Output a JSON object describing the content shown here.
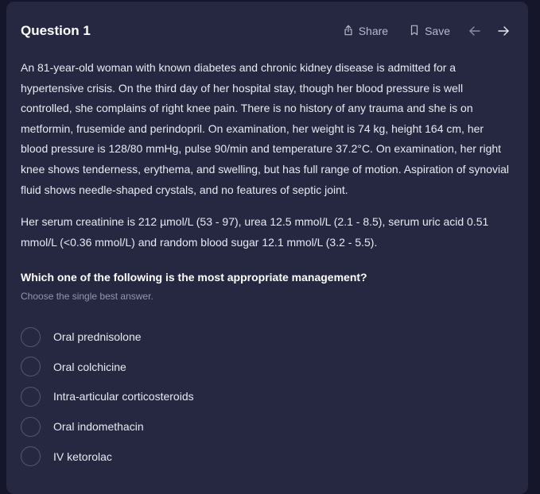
{
  "header": {
    "title": "Question 1",
    "share_label": "Share",
    "save_label": "Save"
  },
  "stem": {
    "paragraph1": "An 81-year-old woman with known diabetes and chronic kidney disease is admitted for a hypertensive crisis. On the third day of her hospital stay, though her blood pressure is well controlled, she complains of right knee pain. There is no history of any trauma and she is on metformin, frusemide and perindopril. On examination, her weight is 74 kg, height 164 cm, her blood pressure is 128/80 mmHg, pulse 90/min and temperature 37.2°C. On examination, her right knee shows tenderness, erythema, and swelling, but has full range of motion. Aspiration of synovial fluid shows needle-shaped crystals, and no features of septic joint.",
    "paragraph2": "Her serum creatinine is 212 µmol/L (53 - 97), urea 12.5 mmol/L (2.1 - 8.5), serum uric acid 0.51 mmol/L (<0.36 mmol/L) and random blood sugar 12.1 mmol/L (3.2 - 5.5)."
  },
  "question": {
    "prompt": "Which one of the following is the most appropriate management?",
    "hint": "Choose the single best answer."
  },
  "options": [
    {
      "label": "Oral prednisolone"
    },
    {
      "label": "Oral colchicine"
    },
    {
      "label": "Intra-articular corticosteroids"
    },
    {
      "label": "Oral indomethacin"
    },
    {
      "label": "IV ketorolac"
    }
  ],
  "icons": {
    "share": "share-icon",
    "save": "bookmark-icon",
    "prev": "arrow-left-icon",
    "next": "arrow-right-icon"
  },
  "colors": {
    "background": "#16162a",
    "card": "#262842",
    "text": "#e8e9f1",
    "muted": "#9496ad",
    "radio_border": "#55576f"
  }
}
